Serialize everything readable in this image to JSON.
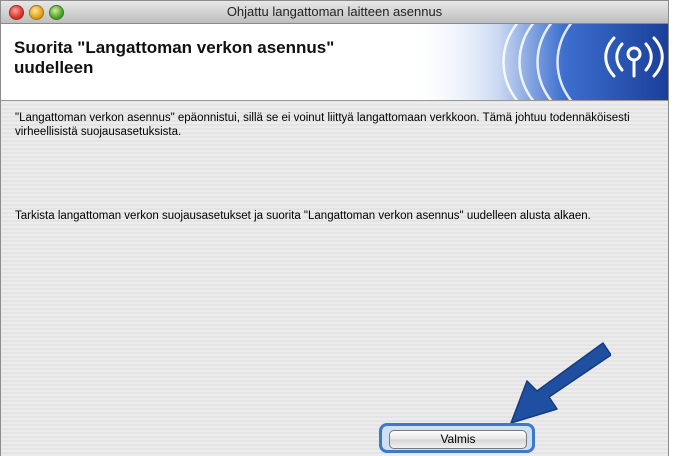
{
  "window": {
    "title": "Ohjattu langattoman laitteen asennus"
  },
  "header": {
    "title_line1": "Suorita \"Langattoman verkon asennus\"",
    "title_line2": "uudelleen",
    "logo_icon": "wireless-signal-icon"
  },
  "content": {
    "paragraph1": "\"Langattoman verkon asennus\" epäonnistui, sillä se ei voinut liittyä langattomaan verkkoon. Tämä johtuu todennäköisesti virheellisistä suojausasetuksista.",
    "paragraph2": "Tarkista langattoman verkon suojausasetukset ja suorita \"Langattoman verkon asennus\" uudelleen alusta alkaen."
  },
  "buttons": {
    "finish_label": "Valmis"
  },
  "colors": {
    "accent_blue": "#3f78c9",
    "arrow_blue": "#1f4fa0"
  }
}
